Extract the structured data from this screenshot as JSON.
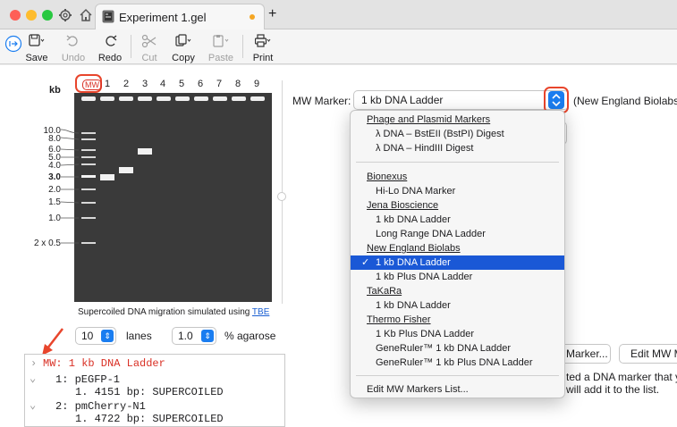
{
  "window": {
    "tab_title": "Experiment 1.gel",
    "new_tab": "+"
  },
  "toolbar": {
    "save": "Save",
    "undo": "Undo",
    "redo": "Redo",
    "cut": "Cut",
    "copy": "Copy",
    "paste": "Paste",
    "print": "Print"
  },
  "gel": {
    "kb_label": "kb",
    "mw_lane": "MW",
    "lanes": [
      "1",
      "2",
      "3",
      "4",
      "5",
      "6",
      "7",
      "8",
      "9"
    ],
    "scale": [
      "10.0",
      "8.0",
      "6.0",
      "5.0",
      "4.0",
      "3.0",
      "2.0",
      "1.5",
      "1.0",
      "2 x 0.5"
    ],
    "sim_text": "Supercoiled DNA migration simulated using ",
    "sim_link": "TBE",
    "lane_count": "10",
    "lanes_label": "lanes",
    "agarose_value": "1.0",
    "agarose_label": "% agarose"
  },
  "tree": {
    "mw_row": "MW:  1 kb DNA Ladder",
    "rows": [
      {
        "head": "1:  pEGFP-1",
        "sub": "1.  4151 bp:  SUPERCOILED"
      },
      {
        "head": "2:  pmCherry-N1",
        "sub": "1.  4722 bp:  SUPERCOILED"
      }
    ]
  },
  "marker": {
    "label": "MW Marker:",
    "selected": "1 kb DNA Ladder",
    "vendor": "(New England Biolabs)",
    "choose_btn": "Marker...",
    "edit_btn": "Edit MW M",
    "help_line1": "ted a DNA marker that you",
    "help_line2": "will add it to the list."
  },
  "dropdown": {
    "groups": [
      {
        "head": "Phage and Plasmid Markers",
        "items": [
          "λ DNA – BstEII (BstPI) Digest",
          "λ DNA – HindIII Digest"
        ]
      },
      {
        "head": "Bionexus",
        "items": [
          "Hi-Lo DNA Marker"
        ]
      },
      {
        "head": "Jena Bioscience",
        "items": [
          "1 kb DNA Ladder",
          "Long Range DNA Ladder"
        ]
      },
      {
        "head": "New England Biolabs",
        "items": [
          "1 kb DNA Ladder",
          "1 kb Plus DNA Ladder"
        ]
      },
      {
        "head": "TaKaRa",
        "items": [
          "1 kb DNA Ladder"
        ]
      },
      {
        "head": "Thermo Fisher",
        "items": [
          "1 Kb Plus DNA Ladder",
          "GeneRuler™ 1 kb DNA Ladder",
          "GeneRuler™ 1 kb Plus DNA Ladder"
        ]
      }
    ],
    "edit_list": "Edit MW Markers List...",
    "checkmark": "✓"
  },
  "colors": {
    "accent": "#1a7df0",
    "selection": "#1a58d6",
    "annotation": "#e8452c",
    "gel": "#3a3a3a",
    "mw_text": "#d93025"
  }
}
